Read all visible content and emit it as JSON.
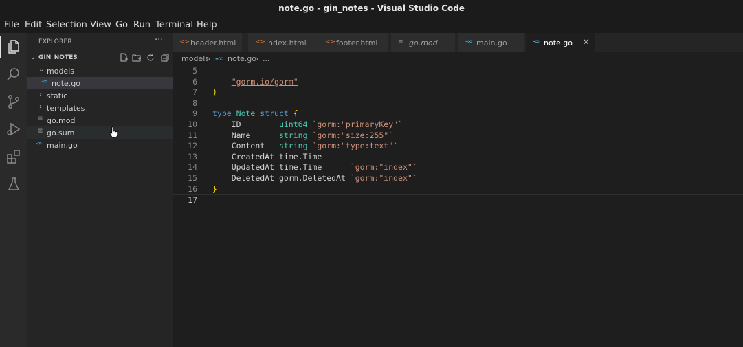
{
  "window": {
    "title": "note.go - gin_notes - Visual Studio Code"
  },
  "menu": [
    "File",
    "Edit",
    "Selection",
    "View",
    "Go",
    "Run",
    "Terminal",
    "Help"
  ],
  "explorer": {
    "header": "EXPLORER",
    "more": "···",
    "project": "GIN_NOTES",
    "tree": {
      "models": "models",
      "note_go": "note.go",
      "static": "static",
      "templates": "templates",
      "go_mod": "go.mod",
      "go_sum": "go.sum",
      "main_go": "main.go"
    }
  },
  "tabs": [
    {
      "label": "header.html",
      "icon": "html-icon"
    },
    {
      "label": "index.html",
      "icon": "html-icon"
    },
    {
      "label": "footer.html",
      "icon": "html-icon"
    },
    {
      "label": "go.mod",
      "icon": "mod-icon"
    },
    {
      "label": "main.go",
      "icon": "go-icon"
    },
    {
      "label": "note.go",
      "icon": "go-icon",
      "active": true
    }
  ],
  "breadcrumb": {
    "folder": "models",
    "file": "note.go",
    "rest": "..."
  },
  "editor": {
    "lines": {
      "l5": "5",
      "l6": "6",
      "l7": "7",
      "l8": "8",
      "l9": "9",
      "l10": "10",
      "l11": "11",
      "l12": "12",
      "l13": "13",
      "l14": "14",
      "l15": "15",
      "l16": "16",
      "l17": "17"
    },
    "code": {
      "import_gorm": "\"gorm.io/gorm\"",
      "close_paren": ")",
      "type_kw": "type",
      "struct_name": "Note",
      "struct_kw": "struct",
      "open_brace": "{",
      "f_id": "ID",
      "t_uint64": "uint64",
      "tag_pk": "`gorm:\"primaryKey\"`",
      "f_name": "Name",
      "t_string": "string",
      "tag_size": "`gorm:\"size:255\"`",
      "f_content": "Content",
      "tag_text": "`gorm:\"type:text\"`",
      "f_created": "CreatedAt",
      "t_time": "time.Time",
      "f_updated": "UpdatedAt",
      "tag_index": "`gorm:\"index\"`",
      "f_deleted": "DeletedAt",
      "t_deleted": "gorm.DeletedAt",
      "close_brace": "}"
    }
  },
  "colors": {
    "accent_go": "#519aba",
    "accent_html": "#e37933",
    "keyword": "#569cd6",
    "type": "#4ec9b0",
    "string": "#ce9178"
  }
}
